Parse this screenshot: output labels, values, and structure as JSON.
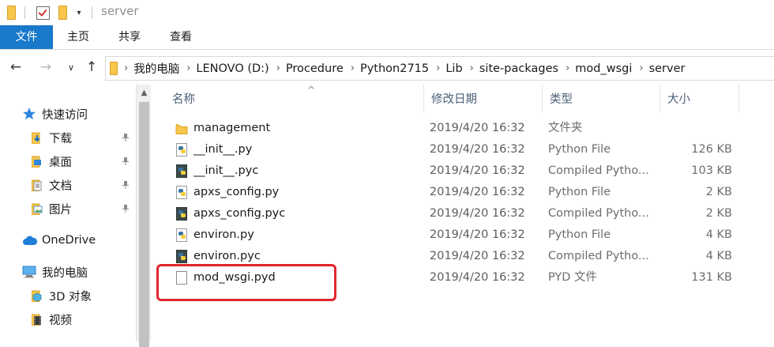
{
  "window": {
    "title": "server"
  },
  "ribbon": {
    "tabs": [
      {
        "label": "文件",
        "active": true
      },
      {
        "label": "主页"
      },
      {
        "label": "共享"
      },
      {
        "label": "查看"
      }
    ]
  },
  "address": {
    "crumbs": [
      "我的电脑",
      "LENOVO (D:)",
      "Procedure",
      "Python2715",
      "Lib",
      "site-packages",
      "mod_wsgi",
      "server"
    ]
  },
  "sidebar": {
    "items": [
      {
        "label": "快速访问",
        "icon": "star-icon"
      },
      {
        "label": "下载",
        "icon": "download-folder-icon",
        "pinned": true
      },
      {
        "label": "桌面",
        "icon": "desktop-folder-icon",
        "pinned": true
      },
      {
        "label": "文档",
        "icon": "documents-folder-icon",
        "pinned": true
      },
      {
        "label": "图片",
        "icon": "pictures-folder-icon",
        "pinned": true
      },
      {
        "label": "OneDrive",
        "icon": "cloud-icon"
      },
      {
        "label": "我的电脑",
        "icon": "computer-icon"
      },
      {
        "label": "3D 对象",
        "icon": "3d-objects-folder-icon"
      },
      {
        "label": "视频",
        "icon": "videos-folder-icon"
      }
    ]
  },
  "columns": {
    "name": "名称",
    "modified": "修改日期",
    "type": "类型",
    "size": "大小"
  },
  "files": [
    {
      "name": "management",
      "modified": "2019/4/20 16:32",
      "type": "文件夹",
      "size": "",
      "icon": "folder-icon"
    },
    {
      "name": "__init__.py",
      "modified": "2019/4/20 16:32",
      "type": "Python File",
      "size": "126 KB",
      "icon": "python-file-icon"
    },
    {
      "name": "__init__.pyc",
      "modified": "2019/4/20 16:32",
      "type": "Compiled Pytho...",
      "size": "103 KB",
      "icon": "compiled-python-icon"
    },
    {
      "name": "apxs_config.py",
      "modified": "2019/4/20 16:32",
      "type": "Python File",
      "size": "2 KB",
      "icon": "python-file-icon"
    },
    {
      "name": "apxs_config.pyc",
      "modified": "2019/4/20 16:32",
      "type": "Compiled Pytho...",
      "size": "2 KB",
      "icon": "compiled-python-icon"
    },
    {
      "name": "environ.py",
      "modified": "2019/4/20 16:32",
      "type": "Python File",
      "size": "4 KB",
      "icon": "python-file-icon"
    },
    {
      "name": "environ.pyc",
      "modified": "2019/4/20 16:32",
      "type": "Compiled Pytho...",
      "size": "4 KB",
      "icon": "compiled-python-icon"
    },
    {
      "name": "mod_wsgi.pyd",
      "modified": "2019/4/20 16:32",
      "type": "PYD 文件",
      "size": "131 KB",
      "icon": "generic-file-icon"
    }
  ],
  "colors": {
    "accent": "#1979ca",
    "highlight": "#e3242b",
    "folder": "#f7c64a"
  }
}
